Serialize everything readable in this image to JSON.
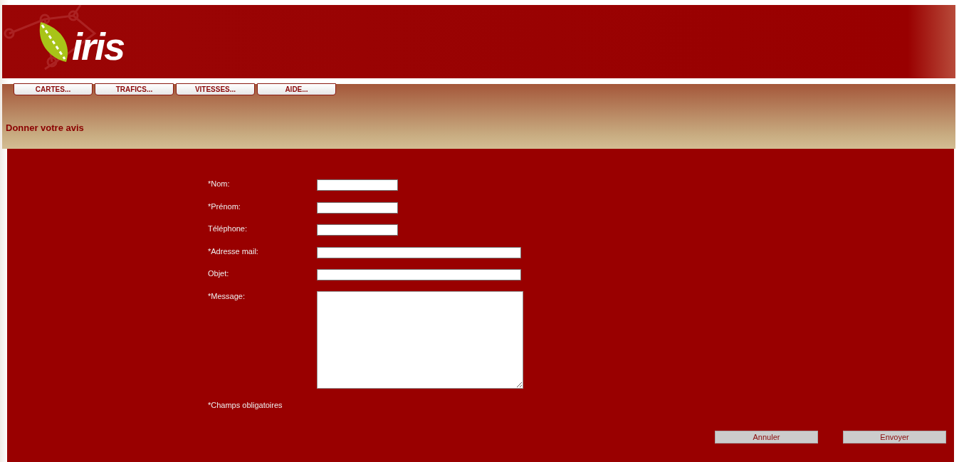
{
  "logo": {
    "text": "iris"
  },
  "menu": [
    {
      "label": "CARTES..."
    },
    {
      "label": "TRAFICS..."
    },
    {
      "label": "VITESSES..."
    },
    {
      "label": "AIDE..."
    }
  ],
  "page_title": "Donner votre avis",
  "form": {
    "fields": [
      {
        "label": "*Nom:",
        "kind": "short"
      },
      {
        "label": "*Prénom:",
        "kind": "short"
      },
      {
        "label": "Téléphone:",
        "kind": "short"
      },
      {
        "label": "*Adresse mail:",
        "kind": "long"
      },
      {
        "label": "Objet:",
        "kind": "long"
      },
      {
        "label": "*Message:",
        "kind": "textarea"
      }
    ],
    "note": "*Champs obligatoires",
    "buttons": [
      "Annuler",
      "Envoyer"
    ]
  }
}
